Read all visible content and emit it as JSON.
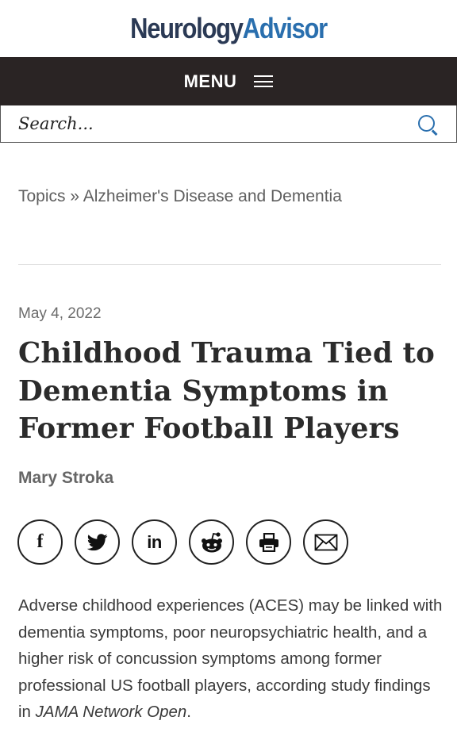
{
  "header": {
    "logo_part1": "Neurology",
    "logo_part2": "Advisor",
    "menu_label": "MENU"
  },
  "search": {
    "placeholder": "Search..."
  },
  "breadcrumb": {
    "topics": "Topics",
    "separator": " » ",
    "category": "Alzheimer's Disease and Dementia"
  },
  "article": {
    "date": "May 4, 2022",
    "title": "Childhood Trauma Tied to Dementia Symptoms in Former Football Players",
    "author": "Mary Stroka",
    "intro_before": "Adverse childhood experiences (ACES) may be linked with dementia symptoms, poor neuropsychiatric health, and a higher risk of concussion symptoms among former professional US football players, according study findings in ",
    "intro_journal": "JAMA Network Open",
    "intro_after": "."
  },
  "share": {
    "facebook_glyph": "f",
    "linkedin_glyph": "in",
    "icons": [
      "facebook-icon",
      "twitter-icon",
      "linkedin-icon",
      "reddit-icon",
      "print-icon",
      "email-icon"
    ]
  },
  "colors": {
    "logo_dark": "#2b3a55",
    "logo_accent": "#2a6fae",
    "menu_bg": "#2a2424",
    "search_icon": "#2a6fae"
  }
}
